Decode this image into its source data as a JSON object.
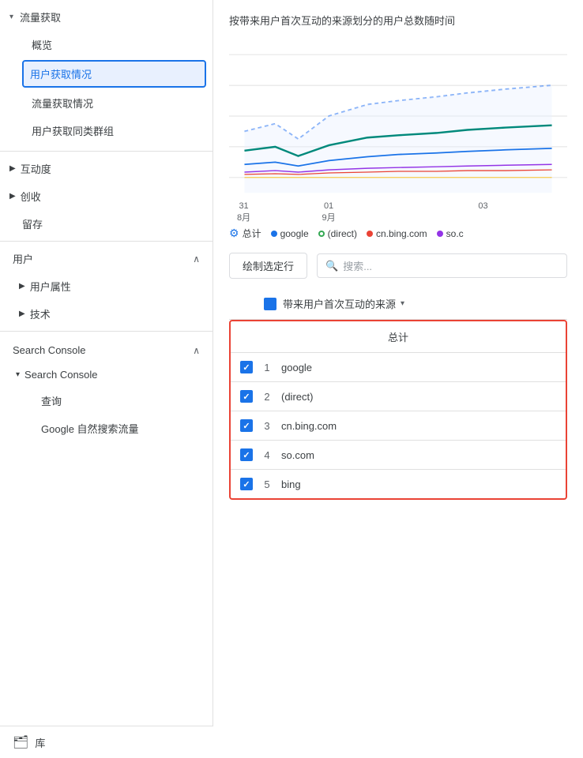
{
  "sidebar": {
    "traffic_section": {
      "label": "流量获取",
      "arrow": "▾",
      "items": [
        {
          "id": "overview",
          "label": "概览",
          "active": false,
          "sub": false
        },
        {
          "id": "user-acquisition",
          "label": "用户获取情况",
          "active": true,
          "sub": false
        },
        {
          "id": "traffic-acquisition",
          "label": "流量获取情况",
          "active": false,
          "sub": false
        },
        {
          "id": "user-cohort",
          "label": "用户获取同类群组",
          "active": false,
          "sub": false
        }
      ]
    },
    "engagement": {
      "label": "互动度",
      "arrow": "▶"
    },
    "monetization": {
      "label": "创收",
      "arrow": "▶"
    },
    "retention": {
      "label": "留存"
    },
    "user_section": {
      "label": "用户",
      "arrow": "▲",
      "items": [
        {
          "id": "user-properties",
          "label": "用户属性",
          "arrow": "▶"
        },
        {
          "id": "tech",
          "label": "技术",
          "arrow": "▶"
        }
      ]
    },
    "search_console_section": {
      "label": "Search Console",
      "arrow": "▲",
      "sub_label": "Search Console",
      "sub_arrow": "▾",
      "sub_items": [
        {
          "id": "query",
          "label": "查询"
        },
        {
          "id": "google-organic",
          "label": "Google 自然搜索流量"
        }
      ]
    },
    "library": {
      "icon": "🗂",
      "label": "库"
    }
  },
  "main": {
    "chart_title": "按带来用户首次互动的来源划分的用户总数随时间",
    "x_labels": [
      "31\n8月",
      "01\n9月",
      "",
      "03",
      ""
    ],
    "legend": [
      {
        "id": "total",
        "type": "gear",
        "label": "总计",
        "color": "#1a73e8"
      },
      {
        "id": "google",
        "type": "dot",
        "label": "google",
        "color": "#1a73e8"
      },
      {
        "id": "direct",
        "type": "dot",
        "label": "(direct)",
        "color": "#34a853"
      },
      {
        "id": "cn-bing",
        "type": "dot",
        "label": "cn.bing.com",
        "color": "#ea4335"
      },
      {
        "id": "so",
        "type": "dot",
        "label": "so.c",
        "color": "#9334e6"
      }
    ],
    "draw_button": "绘制选定行",
    "search_placeholder": "搜索...",
    "column_label": "带来用户首次互动的来源",
    "table_header": "总计",
    "table_rows": [
      {
        "num": 1,
        "source": "google"
      },
      {
        "num": 2,
        "source": "(direct)"
      },
      {
        "num": 3,
        "source": "cn.bing.com"
      },
      {
        "num": 4,
        "source": "so.com"
      },
      {
        "num": 5,
        "source": "bing"
      }
    ]
  }
}
